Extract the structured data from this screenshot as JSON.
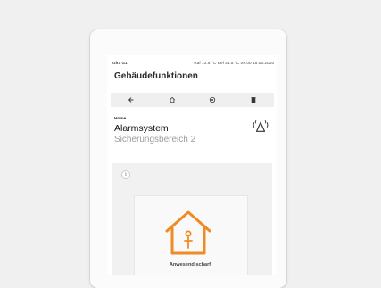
{
  "status": {
    "name": "Gira G1",
    "info": "Raf 12.8 °C  Rel 31.5 °C  09:00  15.03.2016"
  },
  "header": {
    "title": "Gebäudefunktionen"
  },
  "toolbar": {
    "buttons": [
      {
        "icon": "back-arrow-icon"
      },
      {
        "icon": "home-icon"
      },
      {
        "icon": "settings-icon"
      },
      {
        "icon": "trash-icon"
      }
    ]
  },
  "card": {
    "breadcrumb": "Home",
    "title": "Alarmsystem",
    "subtitle": "Sicherungsbereich 2",
    "status_icon": "alarm-bell-icon"
  },
  "panel": {
    "info_label": "i",
    "mode_label": "Anwesend scharf",
    "mode_icon": "house-person-icon"
  },
  "colors": {
    "accent": "#ef8a24",
    "background": "#f0f0f0",
    "screen": "#ffffff",
    "toolbar": "#efefef",
    "subtitle": "#9c9c9c"
  }
}
